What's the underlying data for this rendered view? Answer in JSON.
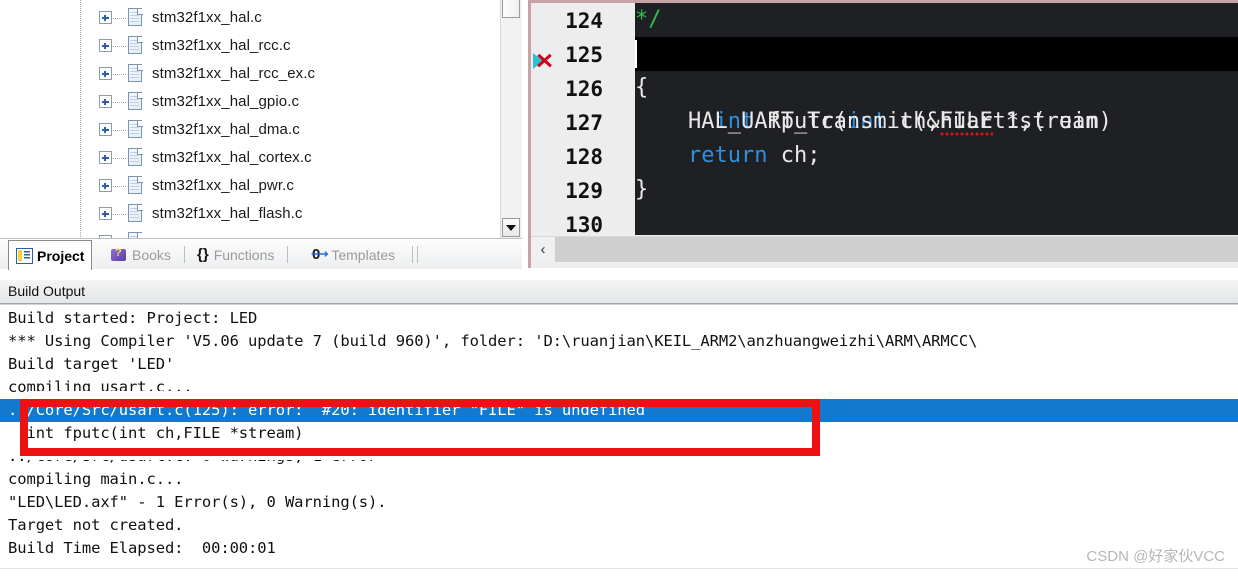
{
  "app": "Keil uVision IDE",
  "project_pane": {
    "files": [
      {
        "label": "stm32f1xx_hal.c",
        "icon": "c-file-icon"
      },
      {
        "label": "stm32f1xx_hal_rcc.c",
        "icon": "c-file-icon"
      },
      {
        "label": "stm32f1xx_hal_rcc_ex.c",
        "icon": "c-file-icon"
      },
      {
        "label": "stm32f1xx_hal_gpio.c",
        "icon": "c-file-icon"
      },
      {
        "label": "stm32f1xx_hal_dma.c",
        "icon": "c-file-icon"
      },
      {
        "label": "stm32f1xx_hal_cortex.c",
        "icon": "c-file-icon"
      },
      {
        "label": "stm32f1xx_hal_pwr.c",
        "icon": "c-file-icon"
      },
      {
        "label": "stm32f1xx_hal_flash.c",
        "icon": "c-file-icon"
      }
    ],
    "expander": "+"
  },
  "tabs": [
    {
      "label": "Project",
      "icon": "project-icon",
      "active": true
    },
    {
      "label": "Books",
      "icon": "books-icon",
      "active": false
    },
    {
      "label": "Functions",
      "icon": "braces-icon",
      "active": false
    },
    {
      "label": "Templates",
      "icon": "templates-icon",
      "active": false
    }
  ],
  "editor": {
    "line_numbers": [
      "124",
      "125",
      "126",
      "127",
      "128",
      "129",
      "130"
    ],
    "lines": [
      {
        "num": "124",
        "text": "*/",
        "style": "comment"
      },
      {
        "num": "125",
        "text": "int fputc(int ch,FILE *stream)",
        "style": "current-error"
      },
      {
        "num": "126",
        "text": "{",
        "style": "plain"
      },
      {
        "num": "127",
        "text": "    HAL_UART_Transmit(&huart1,( uin",
        "style": "plain"
      },
      {
        "num": "128",
        "text": "    return ch;",
        "style": "plain"
      },
      {
        "num": "129",
        "text": "}",
        "style": "plain"
      },
      {
        "num": "130",
        "text": "",
        "style": "plain"
      }
    ],
    "error_marker_line": "125",
    "scroll_left_arrow": "‹",
    "colors": {
      "background": "#1f2024",
      "current_line": "#000000",
      "keyword": "#2f8fe0",
      "comment": "#2fbf4a",
      "text": "#e8e8e8",
      "squiggle": "#d11111"
    }
  },
  "build_output": {
    "title": "Build Output",
    "lines": [
      {
        "text": "Build started: Project: LED",
        "selected": false
      },
      {
        "text": "*** Using Compiler 'V5.06 update 7 (build 960)', folder: 'D:\\ruanjian\\KEIL_ARM2\\anzhuangweizhi\\ARM\\ARMCC\\",
        "selected": false
      },
      {
        "text": "Build target 'LED'",
        "selected": false
      },
      {
        "text": "compiling usart.c...",
        "selected": false
      },
      {
        "text": "../Core/Src/usart.c(125): error:  #20: identifier \"FILE\" is undefined",
        "selected": true
      },
      {
        "text": "  int fputc(int ch,FILE *stream)",
        "selected": false
      },
      {
        "text": "../Core/Src/usart.c: 0 warnings, 1 error",
        "selected": false
      },
      {
        "text": "compiling main.c...",
        "selected": false
      },
      {
        "text": "\"LED\\LED.axf\" - 1 Error(s), 0 Warning(s).",
        "selected": false
      },
      {
        "text": "Target not created.",
        "selected": false
      },
      {
        "text": "Build Time Elapsed:  00:00:01",
        "selected": false
      }
    ],
    "selection_color": "#1279cf"
  },
  "annotation": {
    "shape": "red-rectangle",
    "color": "#ee1111"
  },
  "watermark": {
    "text": "CSDN @好家伙VCC"
  }
}
